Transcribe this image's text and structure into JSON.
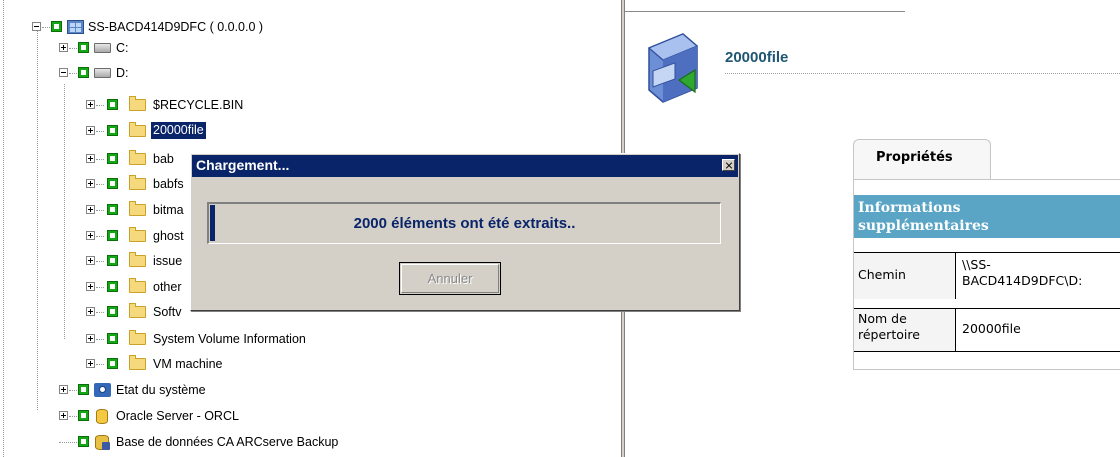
{
  "tree": {
    "root": "SS-BACD414D9DFC ( 0.0.0.0 )",
    "drive_c": "C:",
    "drive_d": "D:",
    "folders": [
      "$RECYCLE.BIN",
      "20000file",
      "bab",
      "babfs",
      "bitma",
      "ghost",
      "issue",
      "other",
      "Softv",
      "System Volume Information",
      "VM machine"
    ],
    "selected_folder": "20000file",
    "system_state": "Etat du système",
    "oracle": "Oracle Server - ORCL",
    "arcserve_db": "Base de données CA ARCserve Backup"
  },
  "dialog": {
    "title": "Chargement...",
    "message": "2000 éléments ont été extraits..",
    "cancel_label": "Annuler",
    "progress_fraction": 0.01
  },
  "details": {
    "title": "20000file",
    "tab_label": "Propriétés",
    "section_title": "Informations supplémentaires",
    "rows": [
      {
        "label": "Chemin",
        "value": "\\\\SS-BACD414D9DFC\\D:"
      },
      {
        "label": "Nom de répertoire",
        "value": "20000file"
      }
    ]
  },
  "colors": {
    "selection": "#0a246a",
    "dialog_bg": "#d4d0c8",
    "check_green": "#13a713",
    "accent_header": "#5aa5c6",
    "title_text": "#1e5673"
  }
}
